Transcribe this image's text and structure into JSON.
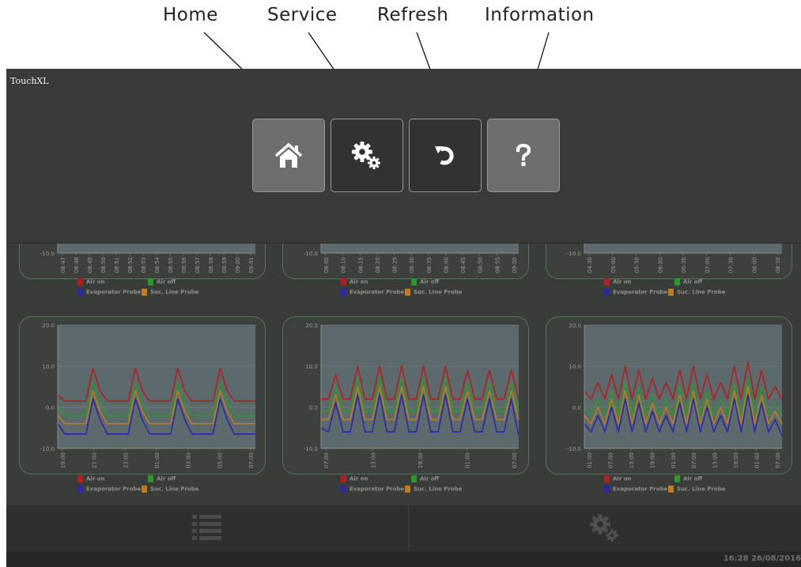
{
  "callouts": [
    {
      "label": "Home"
    },
    {
      "label": "Service"
    },
    {
      "label": "Refresh"
    },
    {
      "label": "Information"
    }
  ],
  "app": {
    "title": "TouchXL"
  },
  "toolbar": {
    "buttons": [
      {
        "name": "home-button",
        "icon": "home-icon",
        "highlighted": true
      },
      {
        "name": "service-button",
        "icon": "gears-icon",
        "highlighted": false
      },
      {
        "name": "refresh-button",
        "icon": "refresh-icon",
        "highlighted": false
      },
      {
        "name": "information-button",
        "icon": "question-icon",
        "highlighted": true
      }
    ]
  },
  "legend": {
    "air_on": "Air on",
    "air_off": "Air off",
    "evaporator": "Evaporator Probe",
    "suction": "Suc. Line Probe"
  },
  "colors": {
    "air_on": "#b02020",
    "air_off": "#2a9a2a",
    "evaporator": "#2a2aa8",
    "suction": "#c07a20",
    "card_border": "#55735a",
    "plot_bg": "#5d6a6d"
  },
  "chart_data": [
    {
      "type": "line",
      "title": "",
      "y_ticks": [
        "-10.0"
      ],
      "x": [
        "08:47",
        "08:48",
        "08:49",
        "08:50",
        "08:51",
        "08:52",
        "08:53",
        "08:54",
        "08:55",
        "08:56",
        "08:57",
        "08:58",
        "08:59",
        "09:00",
        "09:01"
      ],
      "series": [
        {
          "name": "Air on",
          "values": []
        },
        {
          "name": "Air off",
          "values": []
        },
        {
          "name": "Evaporator Probe",
          "values": []
        },
        {
          "name": "Suc. Line Probe",
          "values": []
        }
      ]
    },
    {
      "type": "line",
      "title": "",
      "y_ticks": [
        "-10.0"
      ],
      "x": [
        "08:05",
        "08:10",
        "08:15",
        "08:20",
        "08:25",
        "08:30",
        "08:35",
        "08:40",
        "08:45",
        "08:50",
        "08:55",
        "09:00"
      ],
      "series": [
        {
          "name": "Air on",
          "values": []
        },
        {
          "name": "Air off",
          "values": []
        },
        {
          "name": "Evaporator Probe",
          "values": []
        },
        {
          "name": "Suc. Line Probe",
          "values": []
        }
      ]
    },
    {
      "type": "line",
      "title": "",
      "y_ticks": [
        "-10.0"
      ],
      "x": [
        "04:30",
        "05:00",
        "05:30",
        "06:00",
        "06:30",
        "07:00",
        "07:30",
        "08:00",
        "08:30"
      ],
      "series": [
        {
          "name": "Air on",
          "values": []
        },
        {
          "name": "Air off",
          "values": []
        },
        {
          "name": "Evaporator Probe",
          "values": []
        },
        {
          "name": "Suc. Line Probe",
          "values": []
        }
      ]
    },
    {
      "type": "line",
      "title": "",
      "ylim": [
        -10,
        20
      ],
      "y_ticks": [
        "20.0",
        "10.0",
        "0.0",
        "-10.0"
      ],
      "x": [
        "19:00",
        "21:00",
        "23:00",
        "01:00",
        "03:00",
        "05:00",
        "07:00"
      ],
      "series": [
        {
          "name": "Air on",
          "values": [
            3,
            1.5,
            1.5,
            1.5,
            1.5,
            9.5,
            4,
            1.5,
            1.5,
            1.5,
            1.5,
            9.5,
            4,
            1.5,
            1.5,
            1.5,
            1.5,
            9.5,
            4,
            1.5,
            1.5,
            1.5,
            1.5,
            9.5,
            4,
            1.5,
            1.5,
            1.5,
            1.5
          ]
        },
        {
          "name": "Air off",
          "values": [
            0,
            -2,
            -2,
            -2,
            -2,
            6,
            1,
            -2,
            -2,
            -2,
            -2,
            6,
            1,
            -2,
            -2,
            -2,
            -2,
            6,
            1,
            -2,
            -2,
            -2,
            -2,
            6,
            1,
            -2,
            -2,
            -2,
            -2
          ]
        },
        {
          "name": "Evaporator Probe",
          "values": [
            -4,
            -6.5,
            -6.5,
            -6.5,
            -6.5,
            2,
            -3,
            -6.5,
            -6.5,
            -6.5,
            -6.5,
            2,
            -3,
            -6.5,
            -6.5,
            -6.5,
            -6.5,
            2,
            -3,
            -6.5,
            -6.5,
            -6.5,
            -6.5,
            2,
            -3,
            -6.5,
            -6.5,
            -6.5,
            -6.5
          ]
        },
        {
          "name": "Suc. Line Probe",
          "values": [
            -2,
            -4,
            -4,
            -4,
            -4,
            4,
            -1,
            -4,
            -4,
            -4,
            -4,
            4,
            -1,
            -4,
            -4,
            -4,
            -4,
            4,
            -1,
            -4,
            -4,
            -4,
            -4,
            4,
            -1,
            -4,
            -4,
            -4,
            -4
          ]
        }
      ]
    },
    {
      "type": "line",
      "title": "",
      "ylim": [
        -10,
        20
      ],
      "y_ticks": [
        "20.0",
        "10.0",
        "0.0",
        "-10.0"
      ],
      "x": [
        "07:00",
        "13:00",
        "19:00",
        "01:00",
        "07:00"
      ],
      "series": [
        {
          "name": "Air on",
          "values": [
            2,
            2,
            8,
            2,
            2,
            10,
            2,
            2,
            10,
            2,
            2,
            10,
            2,
            2,
            10,
            2,
            2,
            10,
            2,
            2,
            9,
            2,
            2,
            9,
            2,
            2,
            9,
            2
          ]
        },
        {
          "name": "Air off",
          "values": [
            -1,
            -1,
            5,
            -1,
            -1,
            7,
            -1,
            -1,
            7,
            -1,
            -1,
            7,
            -1,
            -1,
            7,
            -1,
            -1,
            7,
            -1,
            -1,
            6,
            -1,
            -1,
            6,
            -1,
            -1,
            6,
            -1
          ]
        },
        {
          "name": "Evaporator Probe",
          "values": [
            -5,
            -6,
            1,
            -6,
            -6,
            3,
            -6,
            -6,
            3,
            -6,
            -6,
            3,
            -6,
            -6,
            3,
            -6,
            -6,
            3,
            -6,
            -6,
            2,
            -6,
            -6,
            2,
            -6,
            -6,
            2,
            -7
          ]
        },
        {
          "name": "Suc. Line Probe",
          "values": [
            -3,
            -3,
            3,
            -3,
            -3,
            5,
            -3,
            -3,
            5,
            -3,
            -3,
            5,
            -3,
            -3,
            5,
            -3,
            -3,
            5,
            -3,
            -3,
            4,
            -3,
            -3,
            4,
            -3,
            -3,
            4,
            -3
          ]
        }
      ]
    },
    {
      "type": "line",
      "title": "",
      "ylim": [
        -10,
        20
      ],
      "y_ticks": [
        "20.0",
        "10.0",
        "0.0",
        "-10.0"
      ],
      "x": [
        "01:00",
        "07:00",
        "13:00",
        "19:00",
        "01:00",
        "07:00",
        "13:00",
        "19:00",
        "01:00",
        "07:00"
      ],
      "series": [
        {
          "name": "Air on",
          "values": [
            4,
            2,
            6,
            2,
            8,
            2,
            10,
            2,
            9,
            2,
            7,
            2,
            6,
            2,
            9,
            2,
            10,
            2,
            8,
            2,
            6,
            2,
            10,
            2,
            11,
            2,
            9,
            2,
            5,
            2
          ]
        },
        {
          "name": "Air off",
          "values": [
            0,
            -2,
            2,
            -2,
            4,
            -2,
            6,
            -2,
            5,
            -2,
            3,
            -2,
            2,
            -2,
            5,
            -2,
            6,
            -2,
            4,
            -2,
            2,
            -2,
            6,
            -2,
            7,
            -2,
            5,
            -2,
            1,
            -2
          ]
        },
        {
          "name": "Evaporator Probe",
          "values": [
            -4,
            -6,
            -2,
            -6,
            0,
            -6,
            2,
            -6,
            1,
            -6,
            -1,
            -6,
            -2,
            -6,
            1,
            -6,
            2,
            -6,
            0,
            -6,
            -2,
            -6,
            2,
            -6,
            3,
            -6,
            1,
            -6,
            -3,
            -7
          ]
        },
        {
          "name": "Suc. Line Probe",
          "values": [
            -2,
            -4,
            0,
            -4,
            2,
            -4,
            4,
            -4,
            3,
            -4,
            1,
            -4,
            0,
            -4,
            3,
            -4,
            4,
            -4,
            2,
            -4,
            0,
            -4,
            4,
            -4,
            5,
            -4,
            3,
            -4,
            -1,
            -4
          ]
        }
      ]
    }
  ],
  "nav": {
    "left_icon": "list-icon",
    "right_icon": "gears-icon"
  },
  "status": {
    "clock": "16:28 26/08/2016"
  }
}
